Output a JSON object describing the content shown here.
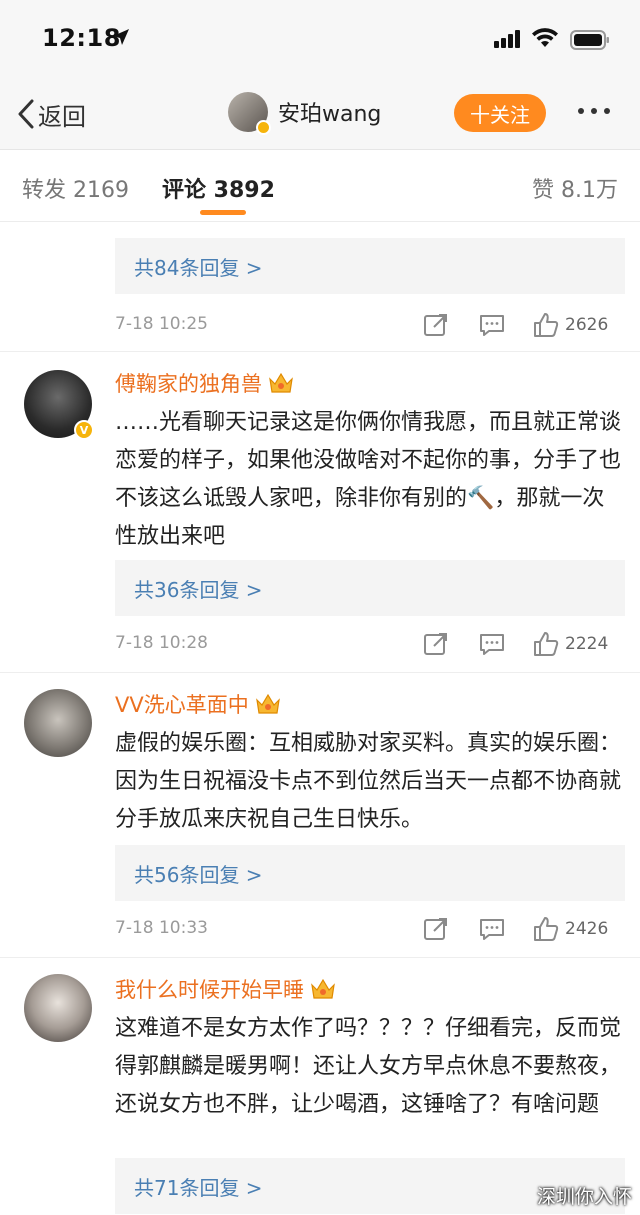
{
  "status_bar": {
    "time": "12:18"
  },
  "nav": {
    "back_label": "返回",
    "author_name": "安珀wang",
    "follow_label": "十关注"
  },
  "tabs": {
    "repost": "转发 2169",
    "comments": "评论 3892",
    "likes": "赞 8.1万"
  },
  "top_partial": {
    "replies": "共84条回复 >",
    "timestamp": "7-18 10:25",
    "likes": "2626"
  },
  "comments": [
    {
      "username": "傅鞠家的独角兽",
      "text": "……光看聊天记录这是你俩你情我愿，而且就正常谈恋爱的样子，如果他没做啥对不起你的事，分手了也不该这么诋毁人家吧，除非你有别的🔨，那就一次性放出来吧",
      "replies": "共36条回复 >",
      "timestamp": "7-18 10:28",
      "likes": "2224"
    },
    {
      "username": "VV洗心革面中",
      "text": "虚假的娱乐圈：互相威胁对家买料。真实的娱乐圈：因为生日祝福没卡点不到位然后当天一点都不协商就分手放瓜来庆祝自己生日快乐。",
      "replies": "共56条回复 >",
      "timestamp": "7-18 10:33",
      "likes": "2426"
    },
    {
      "username": "我什么时候开始早睡",
      "text": "这难道不是女方太作了吗？？？？仔细看完，反而觉得郭麒麟是暖男啊！还让人女方早点休息不要熬夜，还说女方也不胖，让少喝酒，这锤啥了？有啥问题",
      "replies": "共71条回复 >"
    }
  ],
  "watermark": "深圳你入怀",
  "colors": {
    "accent_orange": "#ff8a1f",
    "username_orange": "#eb7020",
    "link_blue": "#4a7fb3",
    "verified_gold": "#f6b40c"
  }
}
